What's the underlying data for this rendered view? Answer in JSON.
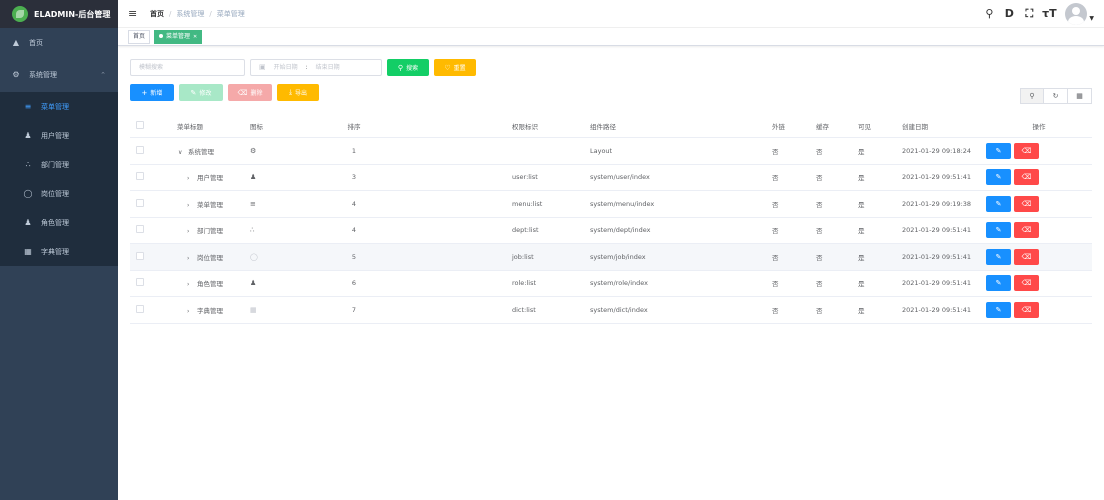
{
  "app": {
    "title": "ELADMIN-后台管理"
  },
  "sidebar": {
    "home": {
      "label": "首页",
      "icon": "dashboard-icon"
    },
    "system": {
      "label": "系统管理",
      "icon": "gear-icon"
    },
    "items": [
      {
        "label": "菜单管理",
        "icon": "menu-icon",
        "active": true
      },
      {
        "label": "用户管理",
        "icon": "users-icon"
      },
      {
        "label": "部门管理",
        "icon": "tree-icon"
      },
      {
        "label": "岗位管理",
        "icon": "person-icon"
      },
      {
        "label": "角色管理",
        "icon": "role-icon"
      },
      {
        "label": "字典管理",
        "icon": "dict-icon"
      }
    ]
  },
  "breadcrumb": [
    "首页",
    "系统管理",
    "菜单管理"
  ],
  "tags": [
    {
      "label": "首页"
    },
    {
      "label": "菜单管理",
      "active": true
    }
  ],
  "search": {
    "placeholder": "模糊搜索",
    "start_placeholder": "开始日期",
    "end_placeholder": "结束日期",
    "search_label": "搜索",
    "reset_label": "重置"
  },
  "actions": {
    "add": "新增",
    "edit": "修改",
    "delete": "删除",
    "export": "导出"
  },
  "table": {
    "headers": [
      "菜单标题",
      "图标",
      "排序",
      "权限标识",
      "组件路径",
      "外链",
      "缓存",
      "可见",
      "创建日期",
      "操作"
    ],
    "rows": [
      {
        "title": "系统管理",
        "icon": "gear-icon",
        "sort": "1",
        "perm": "",
        "path": "Layout",
        "ext": "否",
        "cache": "否",
        "visible": "是",
        "date": "2021-01-29 09:18:24",
        "level": 0,
        "expanded": true
      },
      {
        "title": "用户管理",
        "icon": "users-icon",
        "sort": "3",
        "perm": "user:list",
        "path": "system/user/index",
        "ext": "否",
        "cache": "否",
        "visible": "是",
        "date": "2021-01-29 09:51:41",
        "level": 1
      },
      {
        "title": "菜单管理",
        "icon": "menu-icon",
        "sort": "4",
        "perm": "menu:list",
        "path": "system/menu/index",
        "ext": "否",
        "cache": "否",
        "visible": "是",
        "date": "2021-01-29 09:19:38",
        "level": 1
      },
      {
        "title": "部门管理",
        "icon": "tree-icon",
        "sort": "4",
        "perm": "dept:list",
        "path": "system/dept/index",
        "ext": "否",
        "cache": "否",
        "visible": "是",
        "date": "2021-01-29 09:51:41",
        "level": 1
      },
      {
        "title": "岗位管理",
        "icon": "person-icon",
        "sort": "5",
        "perm": "job:list",
        "path": "system/job/index",
        "ext": "否",
        "cache": "否",
        "visible": "是",
        "date": "2021-01-29 09:51:41",
        "level": 1,
        "highlight": true
      },
      {
        "title": "角色管理",
        "icon": "role-icon",
        "sort": "6",
        "perm": "role:list",
        "path": "system/role/index",
        "ext": "否",
        "cache": "否",
        "visible": "是",
        "date": "2021-01-29 09:51:41",
        "level": 1
      },
      {
        "title": "字典管理",
        "icon": "dict-icon",
        "sort": "7",
        "perm": "dict:list",
        "path": "system/dict/index",
        "ext": "否",
        "cache": "否",
        "visible": "是",
        "date": "2021-01-29 09:51:41",
        "level": 1
      }
    ]
  },
  "colors": {
    "sidebar_bg": "#304156",
    "active": "#409eff",
    "primary": "#1890ff",
    "success": "#13ce66",
    "warning": "#ffba00",
    "danger": "#ff4949",
    "tag_active": "#42b983"
  }
}
